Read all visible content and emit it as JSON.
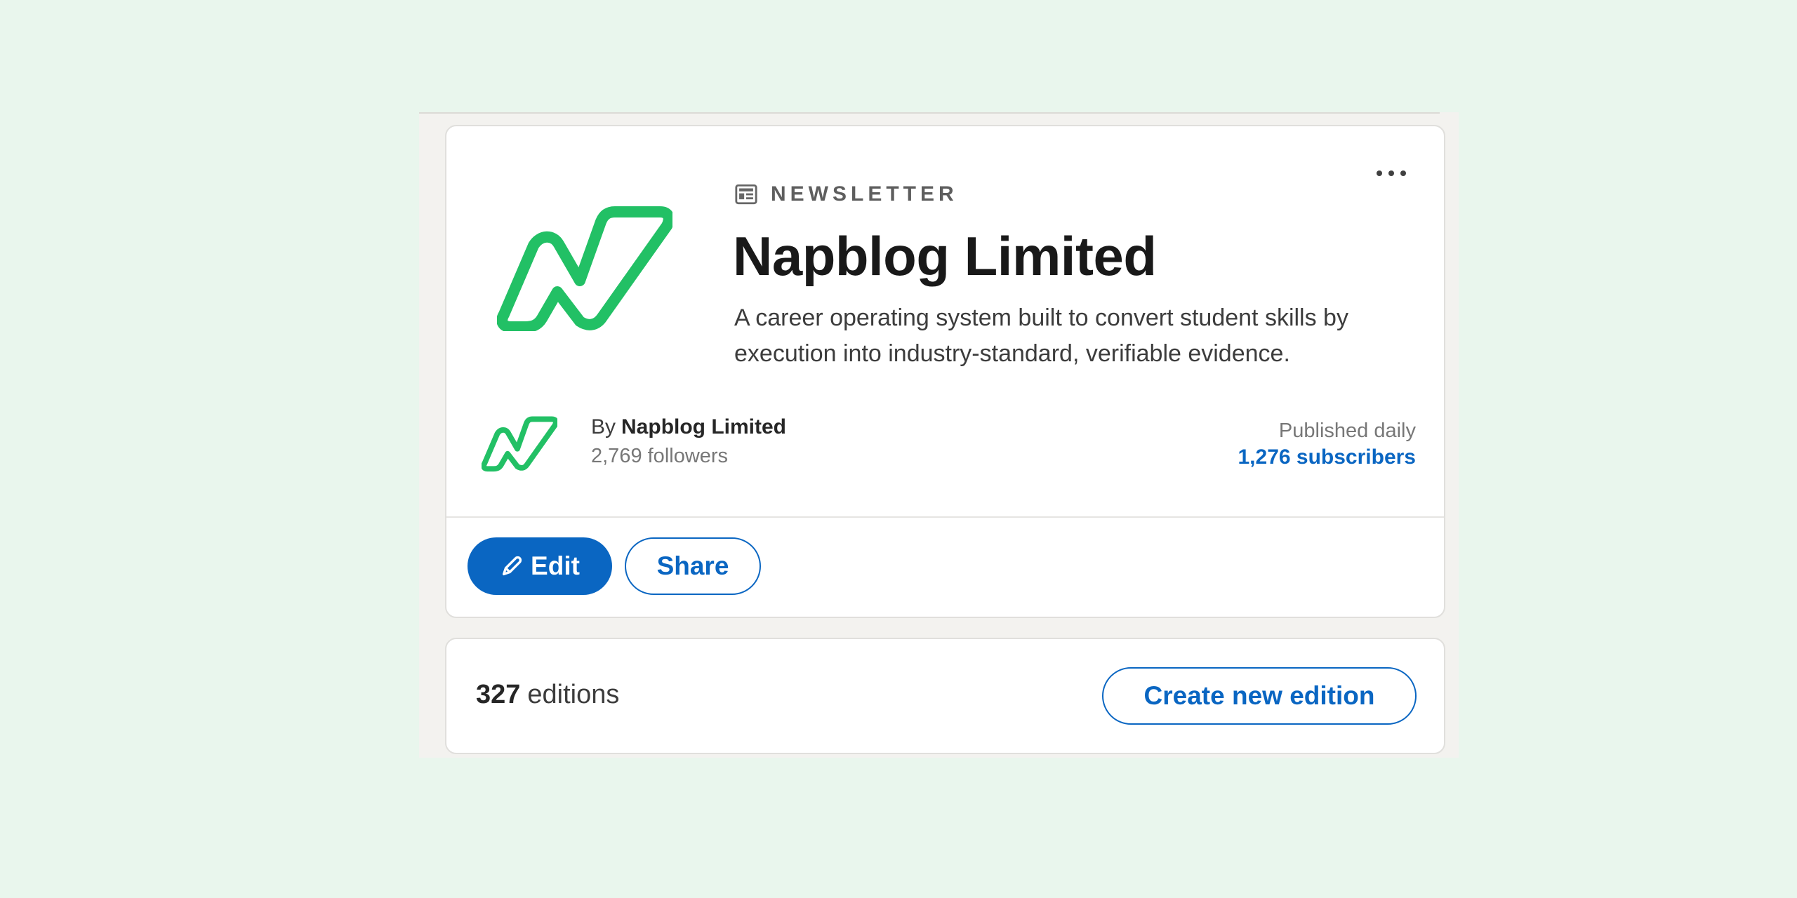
{
  "newsletter": {
    "kicker": "NEWSLETTER",
    "kicker_icon": "newsletter-icon",
    "title": "Napblog Limited",
    "description": "A career operating system built to convert student skills by execution into industry-standard, verifiable evidence.",
    "logo_icon": "napblog-logo",
    "brand_color": "#22c065"
  },
  "author": {
    "by_label": "By",
    "name": "Napblog Limited",
    "followers": "2,769 followers"
  },
  "stats": {
    "frequency": "Published daily",
    "subscribers": "1,276 subscribers"
  },
  "actions": {
    "more_icon": "more-icon",
    "edit_label": "Edit",
    "edit_icon": "pencil-icon",
    "share_label": "Share"
  },
  "editions": {
    "count": "327",
    "count_label": "editions",
    "create_label": "Create new edition"
  },
  "colors": {
    "accent": "#0a66c2",
    "page_background": "#e9f6ed",
    "card_background": "#ffffff"
  }
}
